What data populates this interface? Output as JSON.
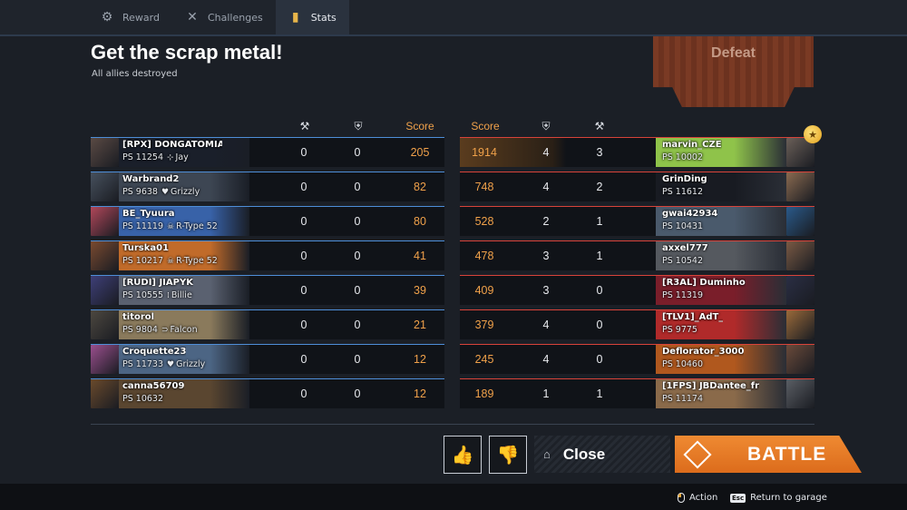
{
  "tabs": [
    {
      "label": "Reward",
      "icon": "reward-icon",
      "active": false
    },
    {
      "label": "Challenges",
      "icon": "crossed-swords-icon",
      "active": false
    },
    {
      "label": "Stats",
      "icon": "stats-icon",
      "active": true
    }
  ],
  "mission": {
    "title": "Get the scrap metal!",
    "subtitle": "All allies destroyed"
  },
  "result": {
    "label": "Defeat"
  },
  "columns": {
    "ally_score": "Score",
    "enemy_score": "Score",
    "kills_icon": "kills-icon",
    "assists_icon": "shield-icon"
  },
  "allies": [
    {
      "name": "[RPX] DONGATOMIA",
      "ps": "PS 11254",
      "robot": "Jay",
      "robot_icon": "crosshair-icon",
      "kills": "0",
      "assists": "0",
      "score": "205",
      "avatar_color": "#5a4a44",
      "plate_color": "#1a1f2a"
    },
    {
      "name": "Warbrand2",
      "ps": "PS 9638",
      "robot": "Grizzly",
      "robot_icon": "heart-icon",
      "kills": "0",
      "assists": "0",
      "score": "82",
      "avatar_color": "#47515e",
      "plate_color": "#3d4653"
    },
    {
      "name": "BE_Tyuura",
      "ps": "PS 11119",
      "robot": "R-Type 52",
      "robot_icon": "skull-icon",
      "kills": "0",
      "assists": "0",
      "score": "80",
      "avatar_color": "#b1475a",
      "plate_color": "#3862a8"
    },
    {
      "name": "Turska01",
      "ps": "PS 10217",
      "robot": "R-Type 52",
      "robot_icon": "skull-icon",
      "kills": "0",
      "assists": "0",
      "score": "41",
      "avatar_color": "#7a4a30",
      "plate_color": "#c16b2a"
    },
    {
      "name": "[RUDI] JIAPYK",
      "ps": "PS 10555",
      "robot": "Billie",
      "robot_icon": "bars-icon",
      "kills": "0",
      "assists": "0",
      "score": "39",
      "avatar_color": "#3e3f78",
      "plate_color": "#5a6170"
    },
    {
      "name": "titorol",
      "ps": "PS 9804",
      "robot": "Falcon",
      "robot_icon": "wings-icon",
      "kills": "0",
      "assists": "0",
      "score": "21",
      "avatar_color": "#4d4840",
      "plate_color": "#8a7a5c"
    },
    {
      "name": "Croquette23",
      "ps": "PS 11733",
      "robot": "Grizzly",
      "robot_icon": "heart-icon",
      "kills": "0",
      "assists": "0",
      "score": "12",
      "avatar_color": "#9b4f8e",
      "plate_color": "#4c6584"
    },
    {
      "name": "canna56709",
      "ps": "PS 10632",
      "robot": "",
      "robot_icon": "",
      "kills": "0",
      "assists": "0",
      "score": "12",
      "avatar_color": "#6a4a2c",
      "plate_color": "#5a4630"
    }
  ],
  "enemies": [
    {
      "name": "marvin_CZE",
      "ps": "PS 10002",
      "score": "1914",
      "assists": "4",
      "kills": "3",
      "avatar_color": "#6a5f58",
      "plate_color": "#8fc34a",
      "score_bg": "#5a3c1e"
    },
    {
      "name": "GrinDing",
      "ps": "PS 11612",
      "score": "748",
      "assists": "4",
      "kills": "2",
      "avatar_color": "#8a6a50",
      "plate_color": "#181b22",
      "score_bg": ""
    },
    {
      "name": "gwai42934",
      "ps": "PS 10431",
      "score": "528",
      "assists": "2",
      "kills": "1",
      "avatar_color": "#2a5a8a",
      "plate_color": "#4a5a6c",
      "score_bg": ""
    },
    {
      "name": "axxel777",
      "ps": "PS 10542",
      "score": "478",
      "assists": "3",
      "kills": "1",
      "avatar_color": "#7a5a44",
      "plate_color": "#55595f",
      "score_bg": ""
    },
    {
      "name": "[R3AL] Duminho",
      "ps": "PS 11319",
      "score": "409",
      "assists": "3",
      "kills": "0",
      "avatar_color": "#2a2e44",
      "plate_color": "#7a1e2a",
      "score_bg": ""
    },
    {
      "name": "[TLV1]_AdT_",
      "ps": "PS 9775",
      "score": "379",
      "assists": "4",
      "kills": "0",
      "avatar_color": "#9a6a3a",
      "plate_color": "#b02a2a",
      "score_bg": ""
    },
    {
      "name": "Deflorator_3000",
      "ps": "PS 10460",
      "score": "245",
      "assists": "4",
      "kills": "0",
      "avatar_color": "#6a4a3a",
      "plate_color": "#b0581e",
      "score_bg": ""
    },
    {
      "name": "[1FPS] JBDantee_fr",
      "ps": "PS 11174",
      "score": "189",
      "assists": "1",
      "kills": "1",
      "avatar_color": "#5a5e64",
      "plate_color": "#8a6a4a",
      "score_bg": ""
    }
  ],
  "buttons": {
    "like_icon": "thumbs-up-icon",
    "dislike_icon": "thumbs-down-icon",
    "close_label": "Close",
    "close_icon": "garage-icon",
    "battle_label": "BATTLE",
    "battle_icon": "battle-diamond-icon"
  },
  "footer": {
    "action_label": "Action",
    "action_key_icon": "mouse-icon",
    "garage_label": "Return to garage",
    "garage_key": "Esc"
  },
  "medal_icon": "medal-icon",
  "colors": {
    "ally_line": "#4e8ed8",
    "enemy_line": "#d8433a",
    "score": "#f0a14a",
    "battle": "#e57a26"
  }
}
